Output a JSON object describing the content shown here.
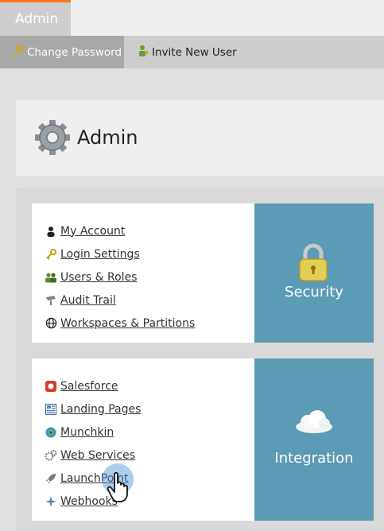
{
  "top_tab": {
    "label": "Admin"
  },
  "toolbar": {
    "change_password": "Change Password",
    "invite_new_user": "Invite New User"
  },
  "header": {
    "title": "Admin"
  },
  "security": {
    "tile_label": "Security",
    "links": [
      {
        "label": "My Account",
        "icon": "user-icon"
      },
      {
        "label": "Login Settings",
        "icon": "key-icon"
      },
      {
        "label": "Users & Roles",
        "icon": "users-icon"
      },
      {
        "label": "Audit Trail",
        "icon": "audit-icon"
      },
      {
        "label": "Workspaces & Partitions",
        "icon": "globe-icon"
      }
    ]
  },
  "integration": {
    "tile_label": "Integration",
    "links": [
      {
        "label": "Salesforce",
        "icon": "salesforce-icon"
      },
      {
        "label": "Landing Pages",
        "icon": "landing-page-icon"
      },
      {
        "label": "Munchkin",
        "icon": "munchkin-icon"
      },
      {
        "label": "Web Services",
        "icon": "gears-icon"
      },
      {
        "label": "LaunchPoint",
        "icon": "rocket-icon"
      },
      {
        "label": "Webhooks",
        "icon": "webhook-icon"
      }
    ]
  },
  "colors": {
    "accent": "#f47a21",
    "tile": "#5b9bb5"
  }
}
